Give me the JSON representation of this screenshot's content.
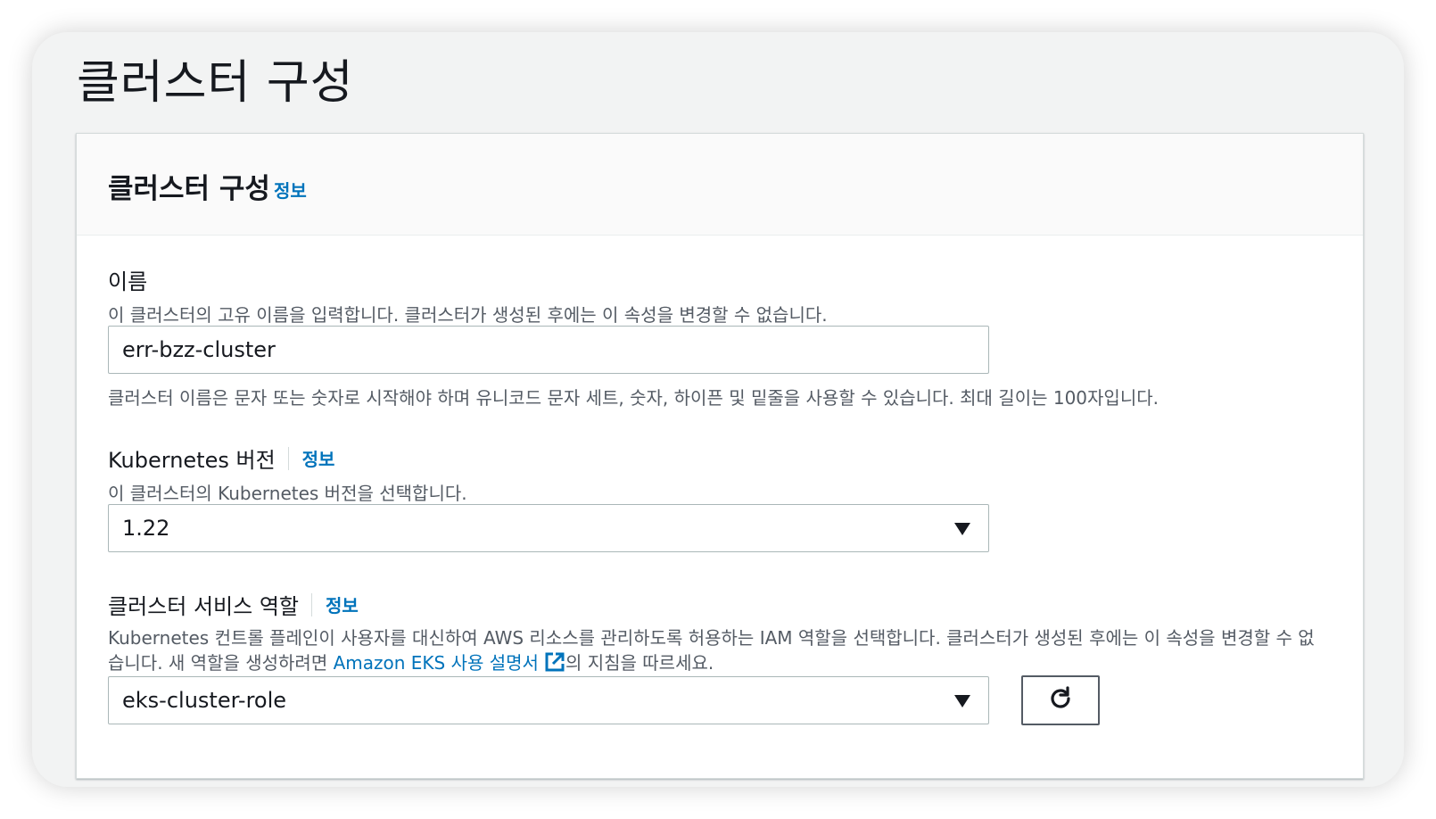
{
  "page_title": "클러스터 구성",
  "panel": {
    "title": "클러스터 구성",
    "info_link": "정보"
  },
  "name_field": {
    "label": "이름",
    "description": "이 클러스터의 고유 이름을 입력합니다. 클러스터가 생성된 후에는 이 속성을 변경할 수 없습니다.",
    "value": "err-bzz-cluster",
    "constraint": "클러스터 이름은 문자 또는 숫자로 시작해야 하며 유니코드 문자 세트, 숫자, 하이픈 및 밑줄을 사용할 수 있습니다. 최대 길이는 100자입니다."
  },
  "version_field": {
    "label": "Kubernetes 버전",
    "info_link": "정보",
    "description": "이 클러스터의 Kubernetes 버전을 선택합니다.",
    "value": "1.22"
  },
  "role_field": {
    "label": "클러스터 서비스 역할",
    "info_link": "정보",
    "description_line1": "Kubernetes 컨트롤 플레인이 사용자를 대신하여 AWS 리소스를 관리하도록 허용하는 IAM 역할을 선택합니다. 클러스터가 생성된 후에는 이 속성을 변경할 수 없",
    "description_line2_prefix": "습니다. 새 역할을 생성하려면",
    "doc_link": "Amazon EKS 사용 설명서",
    "description_line2_suffix": "의 지침을 따르세요.",
    "value": "eks-cluster-role"
  },
  "icons": {
    "dropdown": "caret-down-icon",
    "external": "external-link-icon",
    "refresh": "refresh-icon"
  },
  "colors": {
    "link": "#0073bb",
    "text": "#16191f",
    "muted": "#545b64",
    "border": "#aab7b8"
  }
}
